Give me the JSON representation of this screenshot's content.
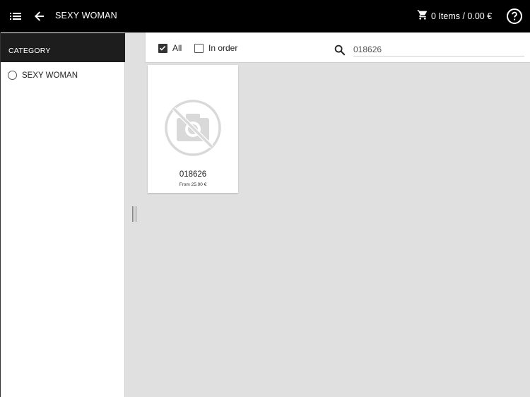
{
  "topbar": {
    "title": "SEXY WOMAN",
    "cart_summary": "0 Items / 0.00 €",
    "icons": {
      "menu": "list-icon",
      "back": "arrow-left-icon",
      "cart": "cart-icon",
      "help": "help-circle-icon"
    }
  },
  "sidebar": {
    "header": "CATEGORY",
    "categories": [
      {
        "label": "SEXY WOMAN",
        "selected": false
      }
    ]
  },
  "filters": {
    "all": {
      "label": "All",
      "checked": true
    },
    "in_order": {
      "label": "In order",
      "checked": false
    },
    "search": {
      "value": "018626",
      "placeholder": ""
    }
  },
  "products": [
    {
      "code": "018626",
      "price": "From 25.90 €",
      "image": "no-photo-icon"
    }
  ],
  "colors": {
    "topbar_bg": "#000000",
    "sidebar_header_bg": "#1d1d1d",
    "content_bg": "#e0e0e0"
  }
}
